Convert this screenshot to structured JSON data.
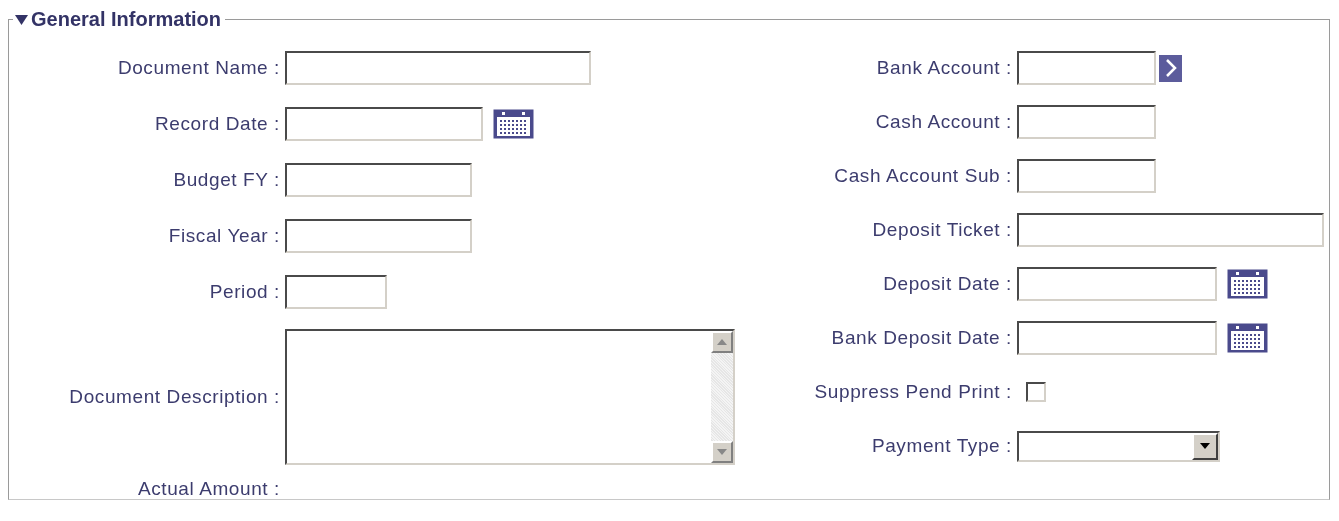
{
  "section": {
    "title": "General Information",
    "expanded": true,
    "left_fields": [
      {
        "label": "Document Name :",
        "kind": "text"
      },
      {
        "label": "Record Date :",
        "kind": "date"
      },
      {
        "label": "Budget FY :",
        "kind": "text"
      },
      {
        "label": "Fiscal Year :",
        "kind": "text"
      },
      {
        "label": "Period :",
        "kind": "text"
      },
      {
        "label": "Document Description :",
        "kind": "textarea"
      },
      {
        "label": "Actual Amount :",
        "kind": "readonly"
      }
    ],
    "right_fields": [
      {
        "label": "Bank Account :",
        "kind": "lookup"
      },
      {
        "label": "Cash Account :",
        "kind": "text"
      },
      {
        "label": "Cash Account Sub :",
        "kind": "text"
      },
      {
        "label": "Deposit Ticket :",
        "kind": "text"
      },
      {
        "label": "Deposit Date :",
        "kind": "date"
      },
      {
        "label": "Bank Deposit Date :",
        "kind": "date"
      },
      {
        "label": "Suppress Pend Print :",
        "kind": "checkbox",
        "checked": false
      },
      {
        "label": "Payment Type :",
        "kind": "select"
      }
    ]
  }
}
